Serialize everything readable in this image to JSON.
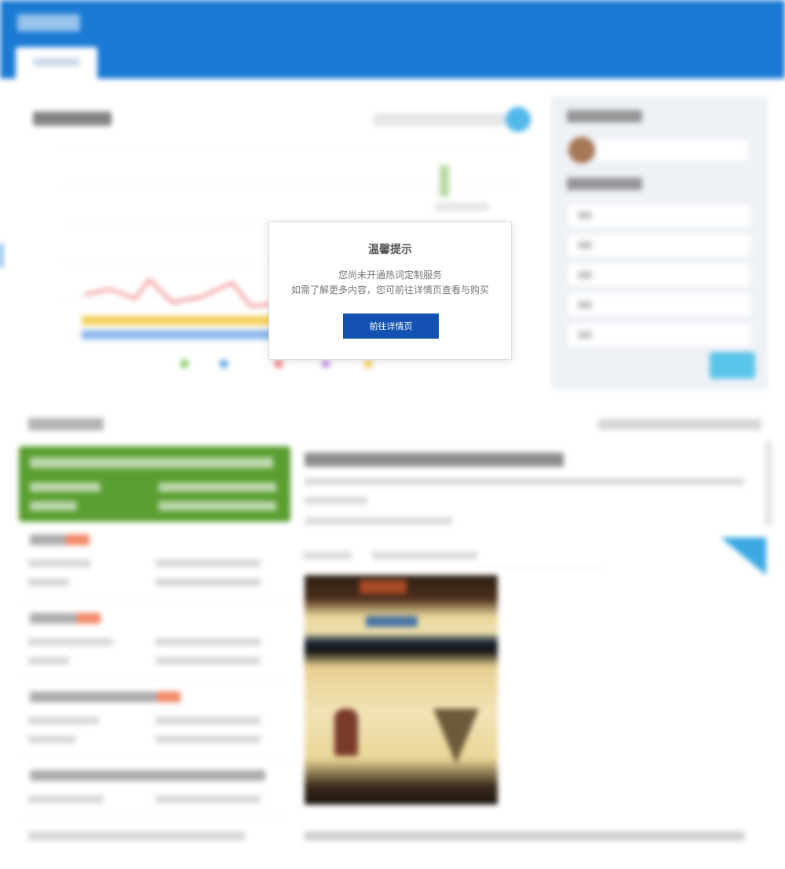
{
  "modal": {
    "title": "温馨提示",
    "message_line1": "您尚未开通热词定制服务",
    "message_line2": "如需了解更多内容，您可前往详情页查看与购买",
    "button_label": "前往详情页"
  },
  "colors": {
    "header": "#1a7ad4",
    "modal_button": "#1352b3",
    "accent_cyan": "#52b8ea",
    "green_card": "#5a9e31",
    "tag_orange": "#f28a6a"
  },
  "icons": {
    "search": "search-icon",
    "avatar": "avatar-icon",
    "corner": "corner-flag-icon"
  }
}
